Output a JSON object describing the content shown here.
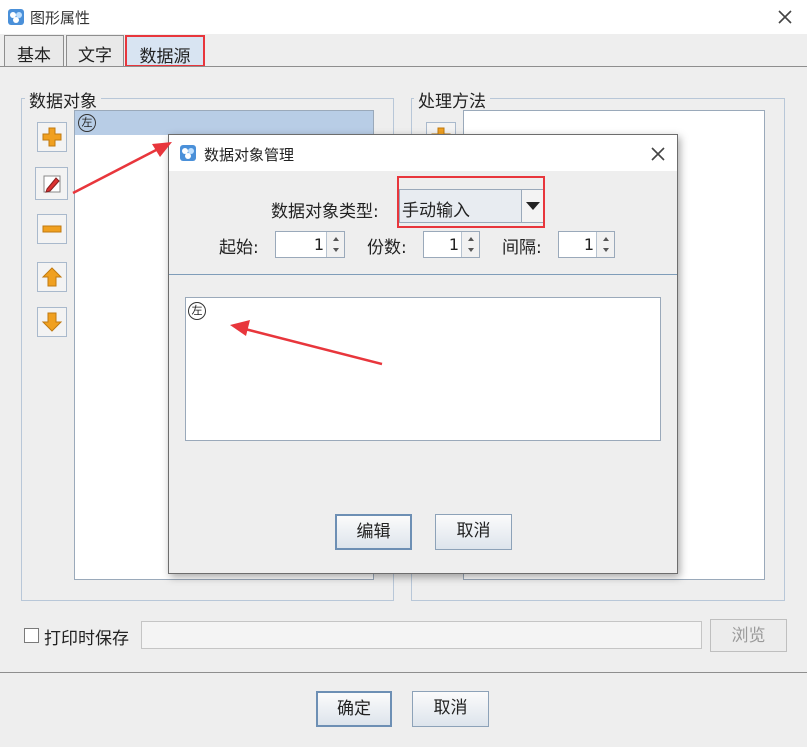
{
  "window": {
    "title": "图形属性"
  },
  "tabs": [
    {
      "label": "基本"
    },
    {
      "label": "文字"
    },
    {
      "label": "数据源"
    }
  ],
  "data_objects": {
    "legend": "数据对象",
    "items": [
      {
        "glyph": "左"
      }
    ]
  },
  "processing": {
    "legend": "处理方法"
  },
  "print_save": {
    "label": "打印时保存",
    "checked": false,
    "path_value": "",
    "browse_label": "浏览"
  },
  "footer": {
    "ok_label": "确定",
    "cancel_label": "取消"
  },
  "dialog": {
    "title": "数据对象管理",
    "type_label": "数据对象类型:",
    "type_value": "手动输入",
    "start_label": "起始:",
    "start_value": "1",
    "copies_label": "份数:",
    "copies_value": "1",
    "interval_label": "间隔:",
    "interval_value": "1",
    "content_glyph": "左",
    "edit_label": "编辑",
    "cancel_label": "取消"
  },
  "colors": {
    "highlight": "#e8363c",
    "accent": "#4a90d9",
    "icon_orange": "#f0a020"
  }
}
